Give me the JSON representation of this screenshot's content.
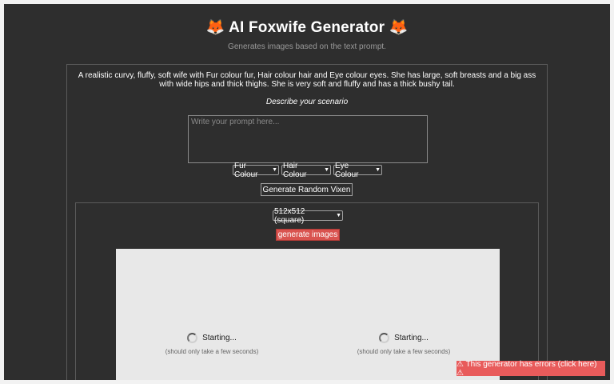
{
  "header": {
    "title": "🦊 AI Foxwife Generator 🦊",
    "subtitle": "Generates images based on the text prompt."
  },
  "description": "A realistic curvy, fluffy, soft wife with Fur colour fur, Hair colour hair and Eye colour eyes. She has large, soft breasts and a big ass with wide hips and thick thighs. She is very soft and fluffy and has a thick bushy tail.",
  "scenario": {
    "label": "Describe your scenario",
    "placeholder": "Write your prompt here..."
  },
  "selects": {
    "fur": "Fur Colour",
    "hair": "Hair Colour",
    "eye": "Eye Colour",
    "size": "512x512 (square)"
  },
  "buttons": {
    "random": "Generate Random Vixen",
    "generate": "generate images"
  },
  "output": {
    "slots": [
      {
        "status": "Starting...",
        "hint": "(should only take a few seconds)"
      },
      {
        "status": "Starting...",
        "hint": "(should only take a few seconds)"
      }
    ]
  },
  "error_banner": "⚠ This generator has errors (click here) ⚠",
  "colors": {
    "background": "#2e2e2e",
    "accent": "#d9534f",
    "error": "#e85b5b"
  }
}
